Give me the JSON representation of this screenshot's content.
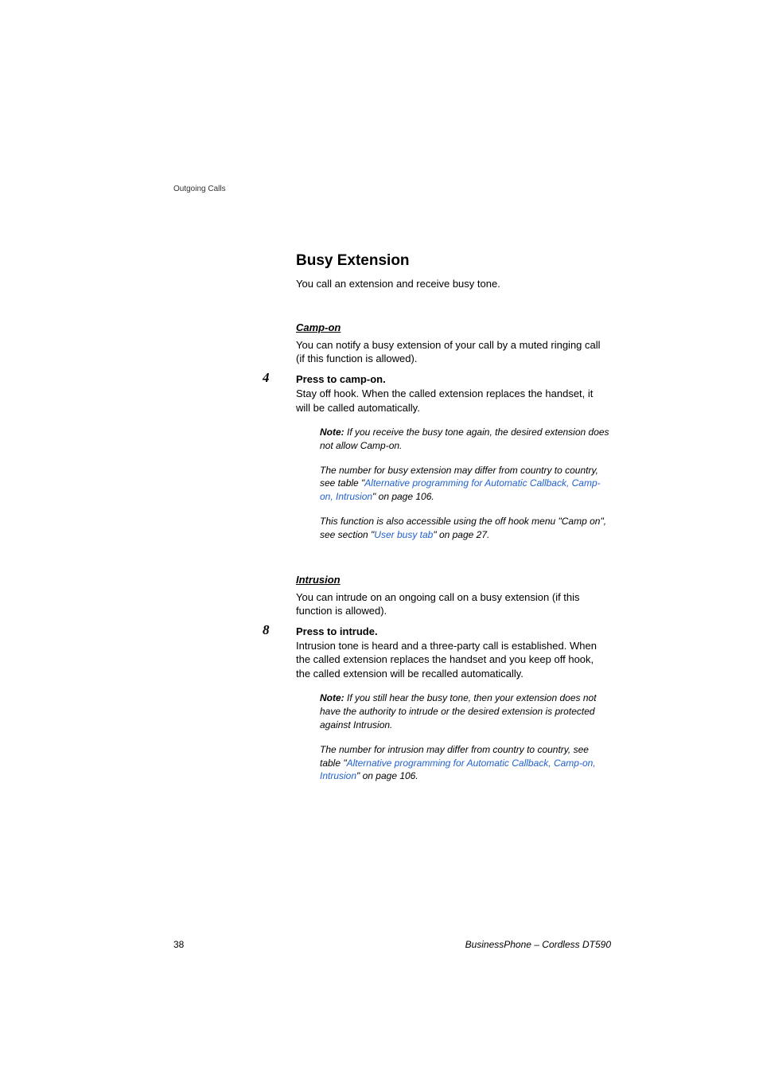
{
  "running_header": "Outgoing Calls",
  "main_heading": "Busy Extension",
  "intro": "You call an extension and receive busy tone.",
  "campon": {
    "heading": "Camp-on",
    "desc": "You can notify a busy extension of your call by a muted ringing call (if this function is allowed).",
    "step_num": "4",
    "step_label": "Press to camp-on.",
    "step_desc": "Stay off hook. When the called extension replaces the handset, it will be called automatically.",
    "note1_label": "Note: ",
    "note1_text": "If you receive the busy tone again, the desired extension does not allow Camp-on.",
    "note2_pre": "The number for busy extension may differ from country to country, see table \"",
    "note2_link": "Alternative programming for Automatic Callback, Camp-on, Intrusion",
    "note2_post": "\" on page 106.",
    "note3_pre": "This function is also accessible using the off hook menu \"Camp on\", see section \"",
    "note3_link": "User busy tab",
    "note3_post": "\" on page 27."
  },
  "intrusion": {
    "heading": "Intrusion",
    "desc": "You can intrude on an ongoing call on a busy extension (if this function is allowed).",
    "step_num": "8",
    "step_label": "Press to intrude.",
    "step_desc": "Intrusion tone is heard and a three-party call is established. When the called extension replaces the handset and you keep off hook, the called extension will be recalled automatically.",
    "note1_label": "Note: ",
    "note1_text": "If you still hear the busy tone, then your extension does not have the authority to intrude or the desired extension is protected against Intrusion.",
    "note2_pre": "The number for intrusion may differ from country to country, see table \"",
    "note2_link": "Alternative programming for Automatic Callback, Camp-on, Intrusion",
    "note2_post": "\" on page 106."
  },
  "footer": {
    "page_num": "38",
    "product": "BusinessPhone – Cordless DT590"
  }
}
